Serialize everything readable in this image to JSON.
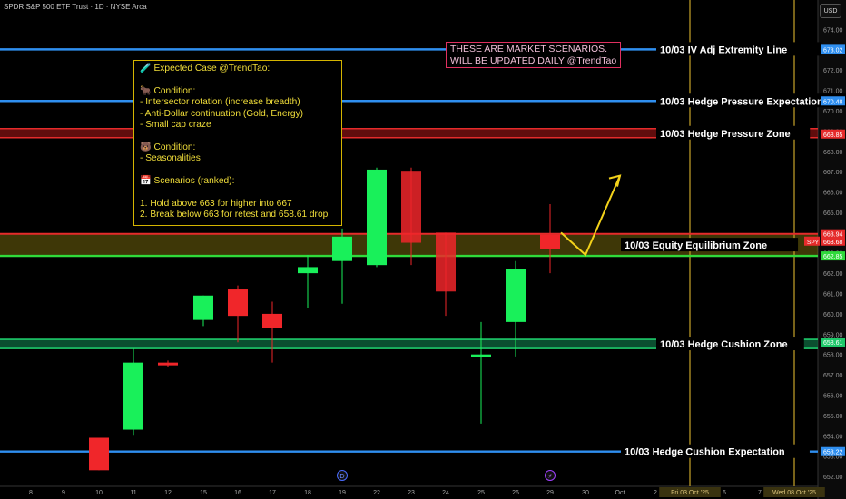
{
  "header": {
    "title": "SPDR S&P 500 ETF Trust · 1D · NYSE Arca",
    "currency": "USD"
  },
  "note": {
    "text": "🧪 Expected Case @TrendTao:\n\n🐂 Condition:\n- Intersector rotation (increase breadth)\n- Anti-Dollar continuation (Gold, Energy)\n- Small cap craze\n\n🐻 Condition:\n- Seasonalities\n\n📅 Scenarios (ranked):\n\n1. Hold above 663 for higher into 667\n2. Break below 663 for retest and 658.61 drop"
  },
  "scenarios_box": {
    "text": "THESE ARE MARKET SCENARIOS.\nWILL BE UPDATED DAILY @TrendTao"
  },
  "chart_data": {
    "type": "candlestick",
    "ylim": [
      651.6,
      674.6
    ],
    "y_ticks": [
      652,
      653,
      654,
      655,
      656,
      657,
      658,
      659,
      660,
      661,
      662,
      663,
      664,
      665,
      666,
      667,
      668,
      669,
      670,
      671,
      672,
      673,
      674
    ],
    "x_ticks": [
      "8",
      "9",
      "10",
      "11",
      "12",
      "15",
      "16",
      "17",
      "18",
      "19",
      "22",
      "23",
      "24",
      "25",
      "26",
      "29",
      "30",
      "Oct",
      "2",
      "Fri 03 Oct '25",
      "6",
      "7",
      "Wed 08 Oct '25"
    ],
    "candles": [
      {
        "day": "10",
        "open": 653.9,
        "high": 653.9,
        "low": 652.3,
        "close": 652.3
      },
      {
        "day": "11",
        "open": 654.3,
        "high": 658.3,
        "low": 654.0,
        "close": 657.6
      },
      {
        "day": "12",
        "open": 657.6,
        "high": 657.7,
        "low": 657.4,
        "close": 657.5
      },
      {
        "day": "15",
        "open": 659.7,
        "high": 660.9,
        "low": 659.4,
        "close": 660.9
      },
      {
        "day": "16",
        "open": 661.2,
        "high": 661.4,
        "low": 658.6,
        "close": 659.9
      },
      {
        "day": "17",
        "open": 660.0,
        "high": 660.6,
        "low": 657.6,
        "close": 659.3
      },
      {
        "day": "18",
        "open": 662.0,
        "high": 662.9,
        "low": 660.3,
        "close": 662.3
      },
      {
        "day": "19",
        "open": 662.6,
        "high": 664.2,
        "low": 660.5,
        "close": 663.8
      },
      {
        "day": "22",
        "open": 662.4,
        "high": 667.2,
        "low": 662.3,
        "close": 667.1
      },
      {
        "day": "23",
        "open": 667.0,
        "high": 667.2,
        "low": 662.4,
        "close": 663.5
      },
      {
        "day": "24",
        "open": 664.0,
        "high": 664.0,
        "low": 659.9,
        "close": 661.1
      },
      {
        "day": "25",
        "open": 657.9,
        "high": 659.6,
        "low": 654.6,
        "close": 658.0
      },
      {
        "day": "26",
        "open": 659.6,
        "high": 662.6,
        "low": 657.9,
        "close": 662.2
      },
      {
        "day": "29",
        "open": 663.9,
        "high": 665.4,
        "low": 662.0,
        "close": 663.2
      }
    ],
    "levels": [
      {
        "label": "10/03 IV Adj Extremity Line",
        "price_label": "673.02",
        "value": 673.02,
        "color": "#2f8ff0"
      },
      {
        "label": "10/03 Hedge Pressure Expectation",
        "price_label": "670.48",
        "value": 670.48,
        "color": "#2f8ff0"
      },
      {
        "label": "10/03 Hedge Pressure Zone",
        "price_label": "668.85",
        "value": 668.85,
        "color": "#e52b2b"
      },
      {
        "label": "10/03 Equity Equilibrium Zone",
        "price_label": "662.85",
        "value": 662.85,
        "color": "#30d93b"
      },
      {
        "label": "10/03 Hedge Cushion Zone",
        "price_label": "658.61",
        "value": 658.61,
        "color": "#1ec96a"
      },
      {
        "label": "10/03 Hedge Cushion Expectation",
        "price_label": "653.22",
        "value": 653.22,
        "color": "#2f8ff0"
      }
    ],
    "equilibrium_band": [
      662.85,
      663.94
    ],
    "price_badges": [
      {
        "text": "663.94",
        "value": 663.94,
        "color": "#e52b2b"
      },
      {
        "text": "663.68",
        "value": 663.58,
        "color": "#e52b2b",
        "tag": "SPY"
      }
    ],
    "vertical_markers": [
      "Fri 03 Oct '25",
      "Wed 08 Oct '25"
    ],
    "event_icons": [
      {
        "day": "19",
        "glyph": "D"
      },
      {
        "day": "29",
        "glyph": "⚡"
      }
    ],
    "scenario_path": [
      {
        "day": "29",
        "value": 664.0
      },
      {
        "day": "30",
        "value": 662.9
      },
      {
        "day": "Oct",
        "value": 666.8
      }
    ]
  }
}
